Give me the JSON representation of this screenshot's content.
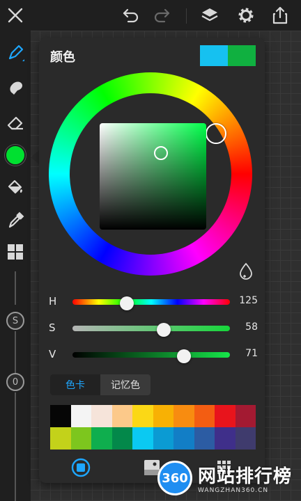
{
  "colors": {
    "accent": "#1ea7ff",
    "current_color": "#00e030",
    "prev_color_a": "#16c1f0",
    "prev_color_b": "#10b040"
  },
  "topbar": {
    "icons": [
      "close-icon",
      "undo-icon",
      "redo-icon",
      "layers-icon",
      "settings-icon",
      "share-icon"
    ]
  },
  "sidebar": {
    "tools": [
      "brush-icon",
      "smudge-icon",
      "eraser-icon",
      "color-icon",
      "fill-icon",
      "eyedropper-icon",
      "grid-icon"
    ],
    "size_label": "S",
    "opacity_label": "0"
  },
  "color_panel": {
    "title": "颜色",
    "hsv": {
      "h_label": "H",
      "h_value": "125",
      "h_fraction": 0.347,
      "s_label": "S",
      "s_value": "58",
      "s_fraction": 0.58,
      "v_label": "V",
      "v_value": "71",
      "v_fraction": 0.71
    },
    "tabs": {
      "swatches": "色卡",
      "history": "记忆色",
      "active": "swatches"
    },
    "palette": {
      "row1": [
        "#060606",
        "#f4f4f4",
        "#f6e4da",
        "#fcc98a",
        "#fbd816",
        "#f8b104",
        "#f88c10",
        "#f35d12",
        "#e8141c",
        "#a31a32"
      ],
      "row2": [
        "#c3d21a",
        "#7dc61e",
        "#0fae4e",
        "#03884a",
        "#0bc9f2",
        "#0b9bd3",
        "#127ec6",
        "#2c5ca3",
        "#3f2f8a",
        "#3f3b6d"
      ]
    }
  },
  "watermark": {
    "badge": "360",
    "text": "网站排行榜",
    "sub": "WANGZHAN360.CN"
  }
}
